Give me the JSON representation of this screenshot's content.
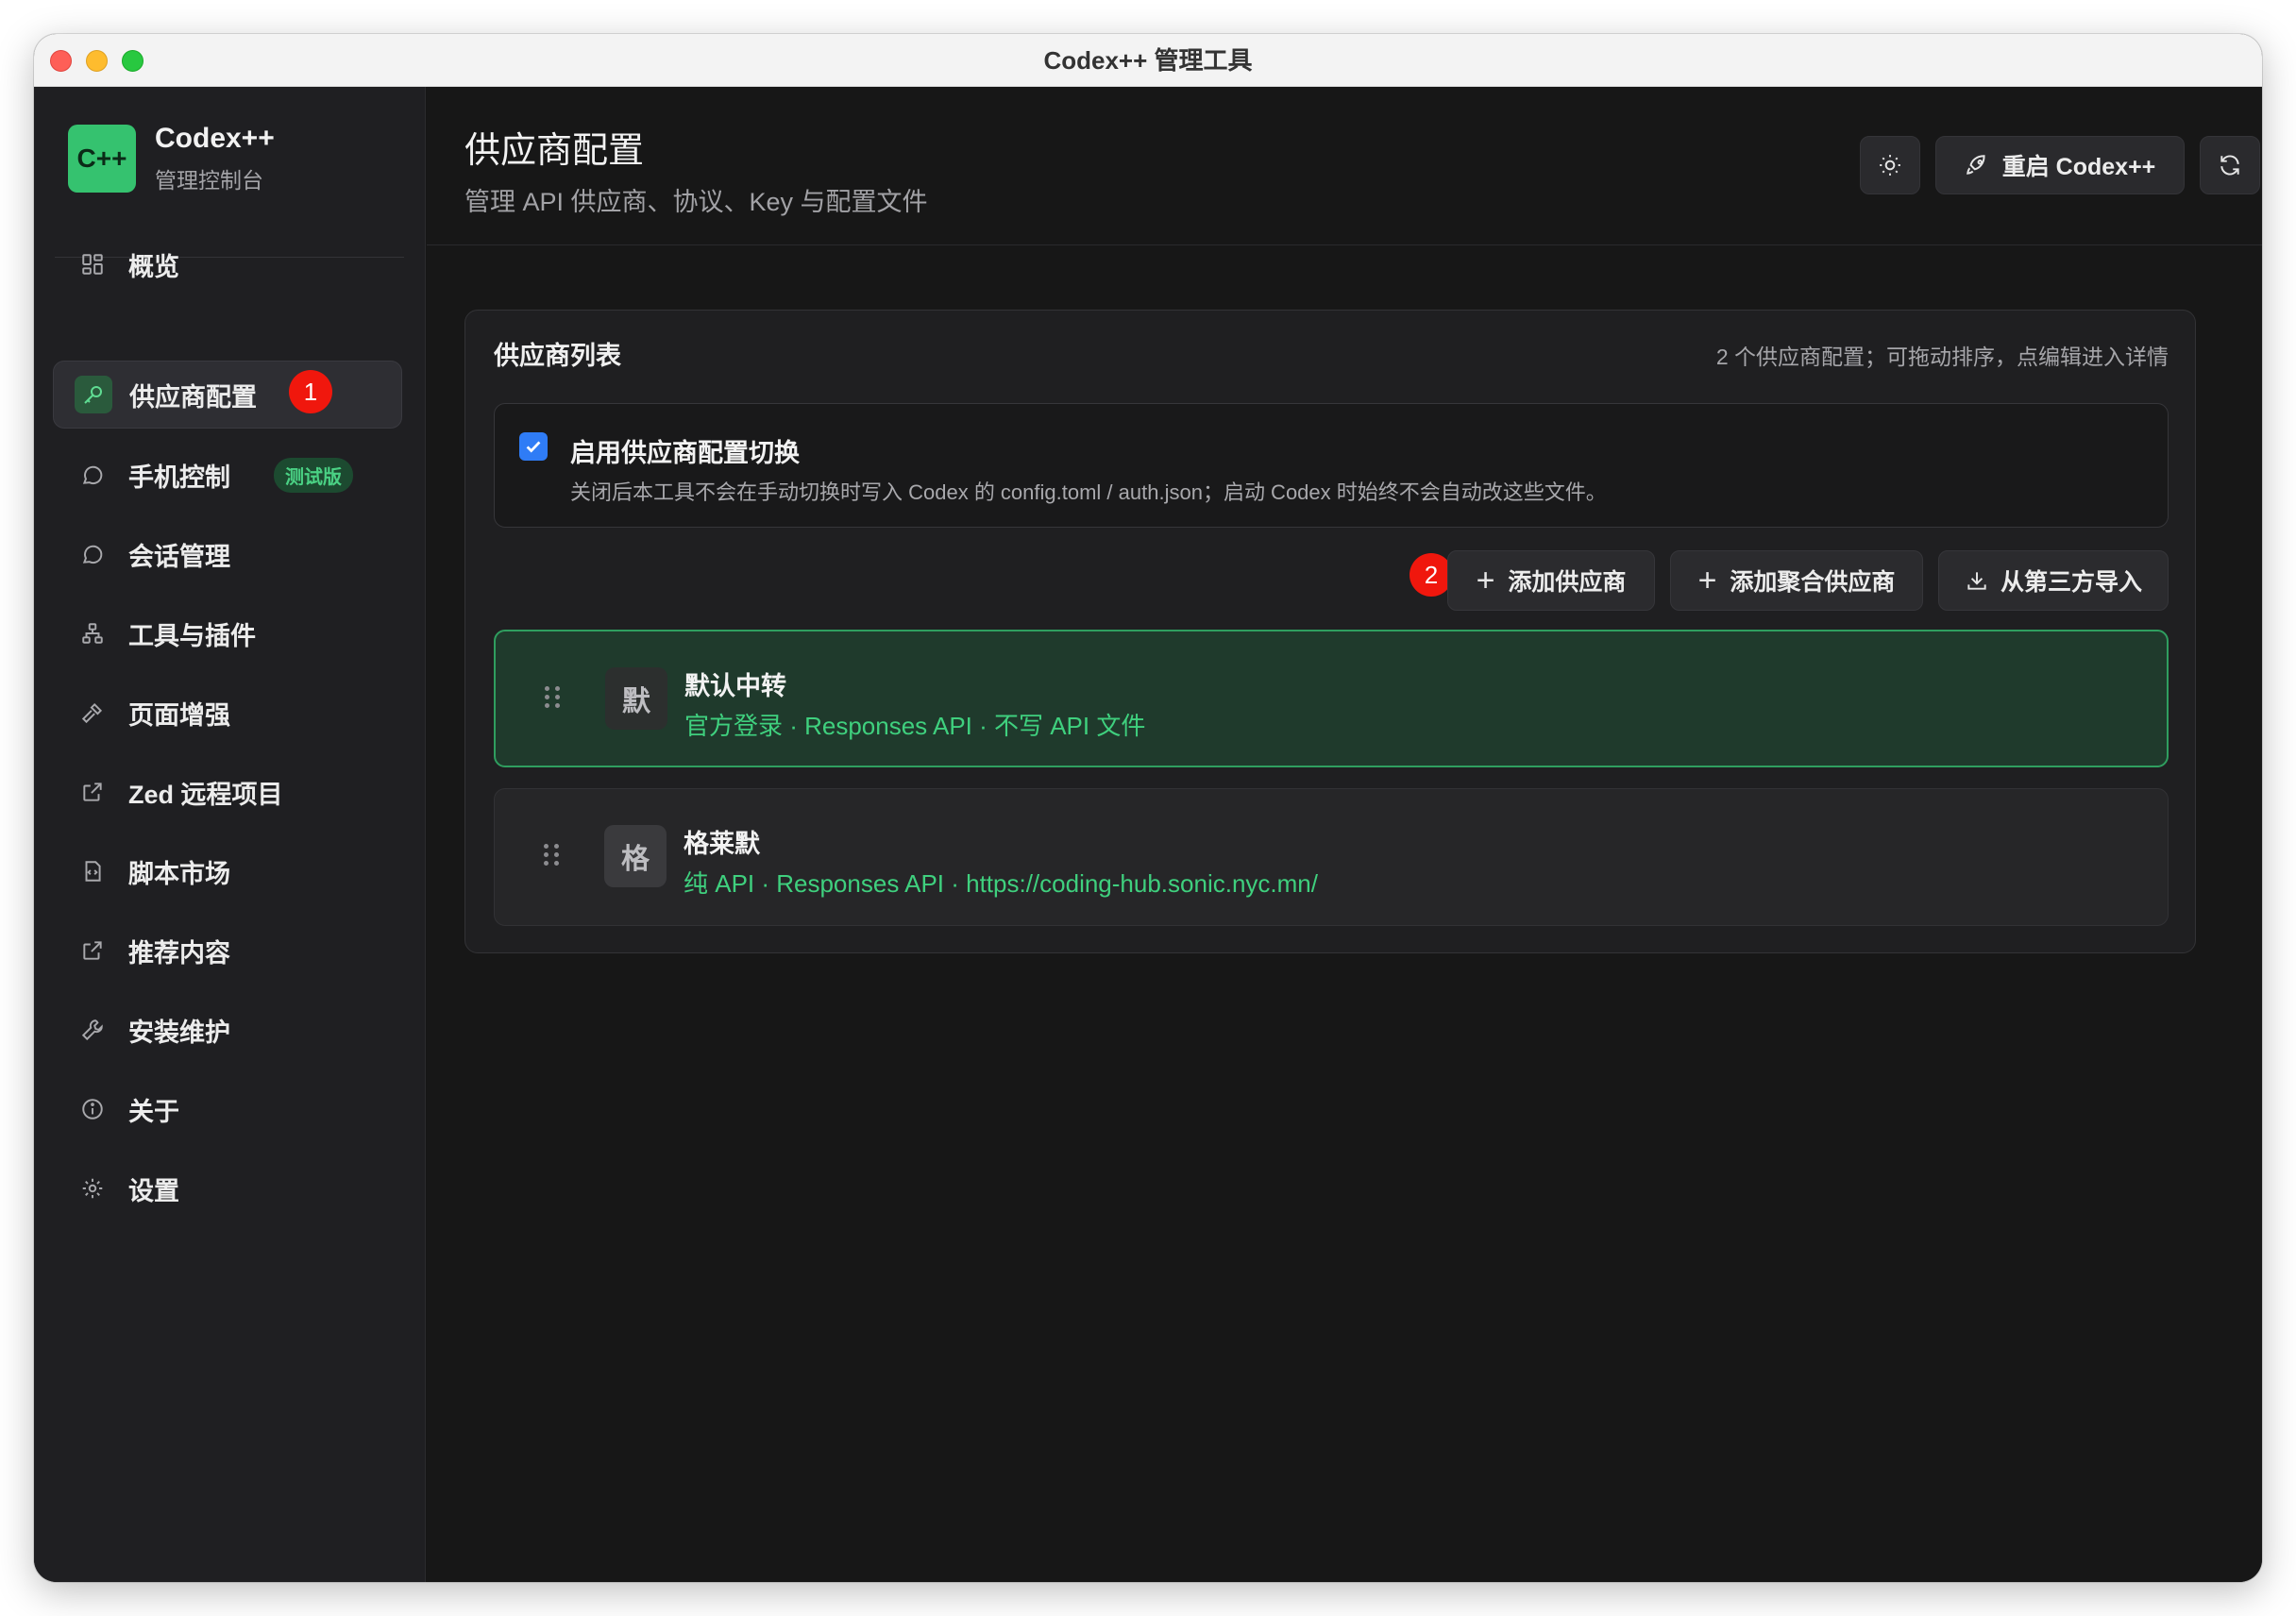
{
  "window": {
    "title": "Codex++ 管理工具"
  },
  "brand": {
    "logo_text": "C++",
    "name": "Codex++",
    "subtitle": "管理控制台"
  },
  "sidebar": {
    "items": [
      {
        "label": "概览",
        "icon": "grid-icon"
      },
      {
        "label": "供应商配置",
        "icon": "key-icon",
        "active": true,
        "step_marker": "1"
      },
      {
        "label": "手机控制",
        "icon": "chat-bubble-icon",
        "badge": "测试版"
      },
      {
        "label": "会话管理",
        "icon": "chat-bubble-icon"
      },
      {
        "label": "工具与插件",
        "icon": "network-icon"
      },
      {
        "label": "页面增强",
        "icon": "hammer-icon"
      },
      {
        "label": "Zed 远程项目",
        "icon": "external-link-icon"
      },
      {
        "label": "脚本市场",
        "icon": "script-icon"
      },
      {
        "label": "推荐内容",
        "icon": "external-link-icon"
      },
      {
        "label": "安装维护",
        "icon": "wrench-icon"
      },
      {
        "label": "关于",
        "icon": "info-icon"
      },
      {
        "label": "设置",
        "icon": "gear-icon"
      }
    ]
  },
  "header": {
    "title": "供应商配置",
    "subtitle": "管理 API 供应商、协议、Key 与配置文件",
    "restart_label": "重启 Codex++"
  },
  "panel": {
    "title": "供应商列表",
    "meta": "2 个供应商配置；可拖动排序，点编辑进入详情",
    "toggle": {
      "checked": true,
      "title": "启用供应商配置切换",
      "description": "关闭后本工具不会在手动切换时写入 Codex 的 config.toml / auth.json；启动 Codex 时始终不会自动改这些文件。"
    },
    "actions": {
      "step_marker": "2",
      "add_provider": "添加供应商",
      "add_aggregate": "添加聚合供应商",
      "import_third_party": "从第三方导入"
    },
    "providers": [
      {
        "avatar": "默",
        "name": "默认中转",
        "detail": "官方登录 · Responses API · 不写 API 文件",
        "active": true
      },
      {
        "avatar": "格",
        "name": "格莱默",
        "detail": "纯 API · Responses API · https://coding-hub.sonic.nyc.mn/",
        "active": false
      }
    ]
  },
  "colors": {
    "accent_green": "#35c26f",
    "active_border": "#2f9e5f",
    "checkbox_blue": "#2f7cf6",
    "step_marker_red": "#f0170d"
  }
}
